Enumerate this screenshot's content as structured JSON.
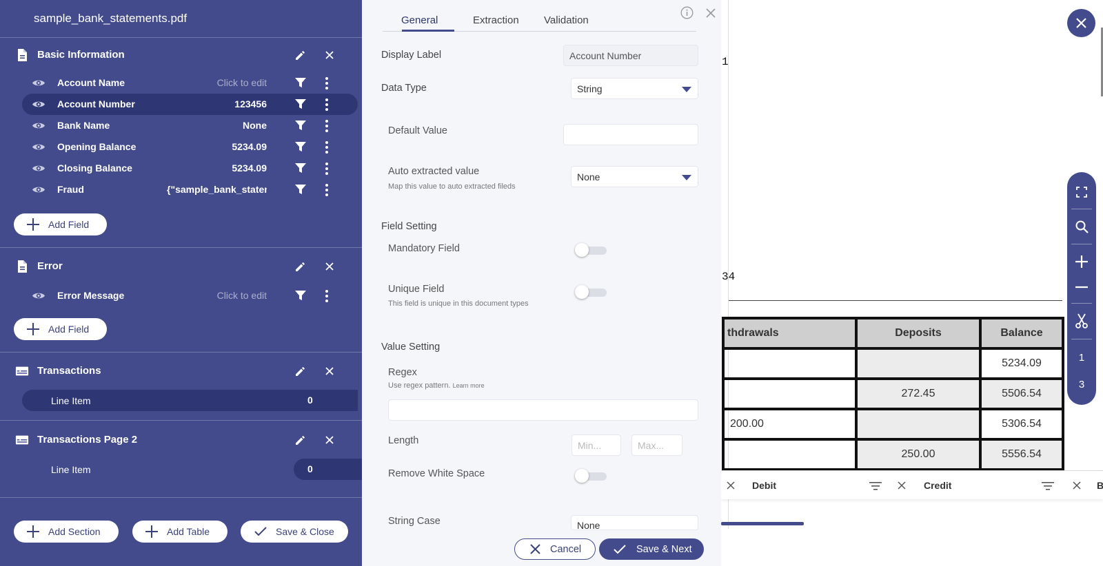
{
  "sidebar": {
    "file_name": "sample_bank_statements.pdf",
    "sections": [
      {
        "title": "Basic Information",
        "fields": [
          {
            "label": "Account Name",
            "value": "Click to edit"
          },
          {
            "label": "Account Number",
            "value": "123456"
          },
          {
            "label": "Bank Name",
            "value": "None"
          },
          {
            "label": "Opening Balance",
            "value": "5234.09"
          },
          {
            "label": "Closing Balance",
            "value": "5234.09"
          },
          {
            "label": "Fraud",
            "value": "{\"sample_bank_statements"
          }
        ],
        "add_field_label": "Add Field"
      },
      {
        "title": "Error",
        "fields": [
          {
            "label": "Error Message",
            "value": "Click to edit"
          }
        ],
        "add_field_label": "Add Field"
      }
    ],
    "tables": [
      {
        "title": "Transactions",
        "line_item_label": "Line Item",
        "line_item_count": "0"
      },
      {
        "title": "Transactions Page 2",
        "line_item_label": "Line Item",
        "line_item_count": "0"
      }
    ],
    "footer": {
      "add_section": "Add Section",
      "add_table": "Add Table",
      "save_close": "Save & Close"
    }
  },
  "panel": {
    "tabs": [
      "General",
      "Extraction",
      "Validation"
    ],
    "active_tab": "General",
    "display_label": {
      "label": "Display Label",
      "value": "Account Number"
    },
    "data_type": {
      "label": "Data Type",
      "value": "String"
    },
    "default_value": {
      "label": "Default Value",
      "value": ""
    },
    "auto_extracted": {
      "label": "Auto extracted value",
      "sub": "Map this value to auto extracted fileds",
      "value": "None"
    },
    "field_setting": {
      "heading": "Field Setting",
      "mandatory": {
        "label": "Mandatory Field",
        "on": false
      },
      "unique": {
        "label": "Unique Field",
        "sub": "This field is unique in this document types",
        "on": false
      }
    },
    "value_setting": {
      "heading": "Value Setting",
      "regex": {
        "label": "Regex",
        "sub": "Use regex pattern.",
        "learn_more": "Learn more",
        "value": ""
      },
      "length": {
        "label": "Length",
        "min_placeholder": "Min...",
        "max_placeholder": "Max..."
      },
      "remove_white_space": {
        "label": "Remove White Space",
        "on": false
      },
      "string_case": {
        "label": "String Case",
        "value": "None"
      }
    },
    "cancel": "Cancel",
    "save_next": "Save & Next"
  },
  "viewer": {
    "snippets": {
      "page_num": "1",
      "line_34": "34"
    },
    "table": {
      "headers": [
        "thdrawals",
        "Deposits",
        "Balance"
      ],
      "rows": [
        [
          "",
          "",
          "5234.09"
        ],
        [
          "",
          "272.45",
          "5506.54"
        ],
        [
          "200.00",
          "",
          "5306.54"
        ],
        [
          "",
          "250.00",
          "5556.54"
        ]
      ]
    },
    "column_bar": {
      "debit": "Debit",
      "credit": "Credit",
      "partial": "B"
    },
    "toolbar_pages": [
      "1",
      "3"
    ]
  },
  "colors": {
    "sidebar": "#434b8c",
    "selected_row": "#2f3674",
    "panel_bg": "#f5f6fa"
  }
}
